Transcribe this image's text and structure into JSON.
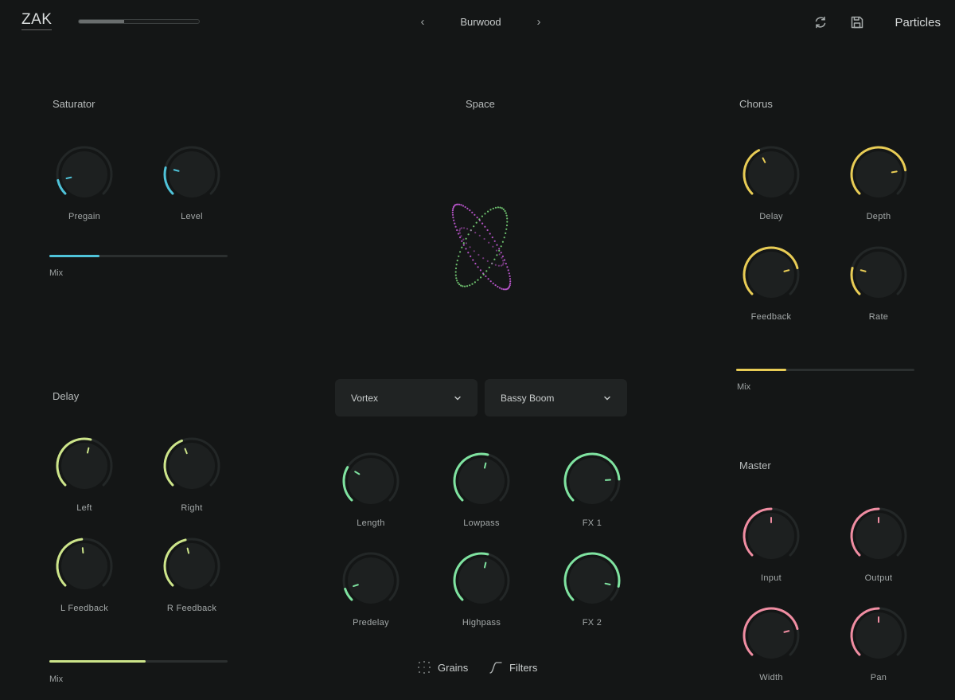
{
  "header": {
    "logo": "ZAK",
    "preset": "Burwood",
    "prev_arrow": "‹",
    "next_arrow": "›",
    "plugin_name": "Particles",
    "progress": 0.38
  },
  "colors": {
    "background": "#141616",
    "saturator": "#4fc3d9",
    "delay": "#cde58a",
    "space": "#7fe3a0",
    "chorus": "#e8cc55",
    "master": "#f08da2"
  },
  "saturator": {
    "title": "Saturator",
    "knobs": [
      {
        "label": "Pregain",
        "value": 0.12
      },
      {
        "label": "Level",
        "value": 0.22
      }
    ],
    "mix_label": "Mix",
    "mix_value": 0.28
  },
  "delay": {
    "title": "Delay",
    "knobs": [
      {
        "label": "Left",
        "value": 0.55
      },
      {
        "label": "Right",
        "value": 0.42
      },
      {
        "label": "L Feedback",
        "value": 0.48
      },
      {
        "label": "R Feedback",
        "value": 0.45
      }
    ],
    "mix_label": "Mix",
    "mix_value": 0.54
  },
  "space": {
    "title": "Space",
    "dropdown_1": "Vortex",
    "dropdown_2": "Bassy Boom",
    "knobs": [
      {
        "label": "Length",
        "value": 0.28
      },
      {
        "label": "Lowpass",
        "value": 0.55
      },
      {
        "label": "FX 1",
        "value": 0.82
      },
      {
        "label": "Predelay",
        "value": 0.1
      },
      {
        "label": "Highpass",
        "value": 0.55
      },
      {
        "label": "FX 2",
        "value": 0.88
      }
    ],
    "tabs": [
      {
        "label": "Grains",
        "icon": "grains-icon"
      },
      {
        "label": "Filters",
        "icon": "filters-icon"
      }
    ]
  },
  "chorus": {
    "title": "Chorus",
    "knobs": [
      {
        "label": "Delay",
        "value": 0.4
      },
      {
        "label": "Depth",
        "value": 0.8
      },
      {
        "label": "Feedback",
        "value": 0.78
      },
      {
        "label": "Rate",
        "value": 0.22
      }
    ],
    "mix_label": "Mix",
    "mix_value": 0.28
  },
  "master": {
    "title": "Master",
    "knobs": [
      {
        "label": "Input",
        "value": 0.5
      },
      {
        "label": "Output",
        "value": 0.5
      },
      {
        "label": "Width",
        "value": 0.78
      },
      {
        "label": "Pan",
        "value": 0.5
      }
    ]
  }
}
